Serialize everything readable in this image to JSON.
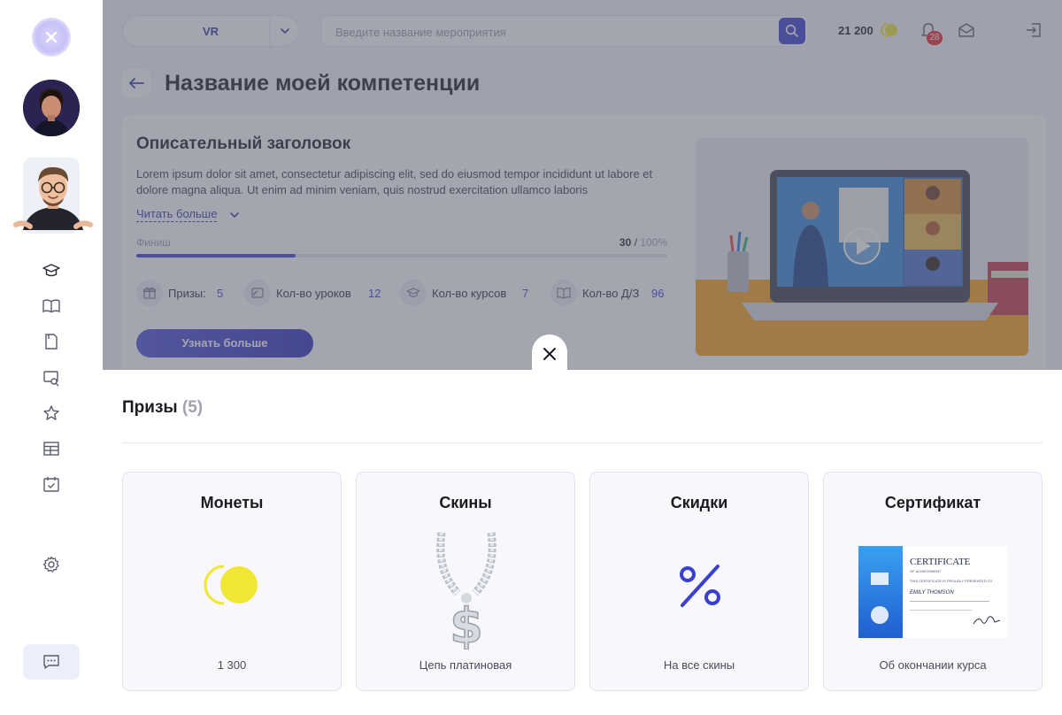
{
  "header": {
    "selector_value": "VR",
    "search_placeholder": "Введите название мероприятия",
    "coins": "21 200",
    "notifications_count": "28"
  },
  "page": {
    "title": "Название моей компетенции"
  },
  "competency_card": {
    "title": "Описательный заголовок",
    "description": "Lorem ipsum dolor sit amet, consectetur adipiscing elit, sed do eiusmod tempor incididunt ut labore et dolore magna aliqua. Ut enim ad minim veniam, quis nostrud exercitation ullamco laboris",
    "read_more": "Читать больше",
    "progress_label": "Финиш",
    "progress_current": "30",
    "progress_separator": " / ",
    "progress_max": "100%",
    "progress_fraction": 0.3,
    "stats": [
      {
        "label": "Призы:",
        "value": "5",
        "icon": "gift-icon"
      },
      {
        "label": "Кол-во уроков",
        "value": "12",
        "icon": "lesson-icon"
      },
      {
        "label": "Кол-во курсов",
        "value": "7",
        "icon": "graduation-cap-icon"
      },
      {
        "label": "Кол-во Д/З",
        "value": "96",
        "icon": "book-icon"
      }
    ],
    "learn_more_button": "Узнать больше"
  },
  "prizes_panel": {
    "title": "Призы",
    "count": "(5)",
    "items": [
      {
        "name": "Монеты",
        "subtitle": "1 300",
        "icon": "coins-icon"
      },
      {
        "name": "Скины",
        "subtitle": "Цепь платиновая",
        "icon": "chain-icon"
      },
      {
        "name": "Скидки",
        "subtitle": "На все скины",
        "icon": "percent-icon"
      },
      {
        "name": "Сертификат",
        "subtitle": "Об окончании курса",
        "icon": "certificate-icon"
      }
    ]
  },
  "certificate_image": {
    "heading": "CERTIFICATE",
    "subheading": "OF ACHIEVEMENT",
    "line": "THIS CERTIFICATE IS PROUDLY PRESENTED TO",
    "recipient": "EMILY THOMSON"
  },
  "colors": {
    "accent": "#3a3fd0",
    "coin_yellow": "#f0e634",
    "badge_red": "#e5262f"
  }
}
